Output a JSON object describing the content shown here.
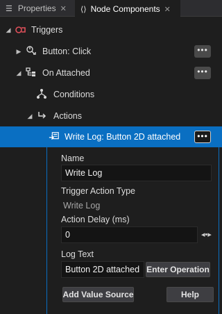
{
  "tabs": [
    {
      "label": "Properties",
      "active": false
    },
    {
      "label": "Node Components",
      "active": true
    }
  ],
  "tree": {
    "triggers": {
      "label": "Triggers"
    },
    "button_click": {
      "label": "Button: Click",
      "more": "•••"
    },
    "on_attached": {
      "label": "On Attached",
      "more": "•••"
    },
    "conditions": {
      "label": "Conditions"
    },
    "actions": {
      "label": "Actions"
    },
    "write_log": {
      "label": "Write Log: Button 2D attached",
      "more": "•••"
    }
  },
  "props": {
    "name_label": "Name",
    "name_value": "Write Log",
    "type_label": "Trigger Action Type",
    "type_value": "Write Log",
    "delay_label": "Action Delay (ms)",
    "delay_value": "0",
    "logtext_label": "Log Text",
    "logtext_value": "Button 2D attached",
    "enter_operation": "Enter Operation",
    "add_value_source": "Add Value Source",
    "help": "Help"
  },
  "colors": {
    "selection": "#0a6fc2",
    "background": "#1e1e1e",
    "trigger_icon": "#e0505a"
  }
}
